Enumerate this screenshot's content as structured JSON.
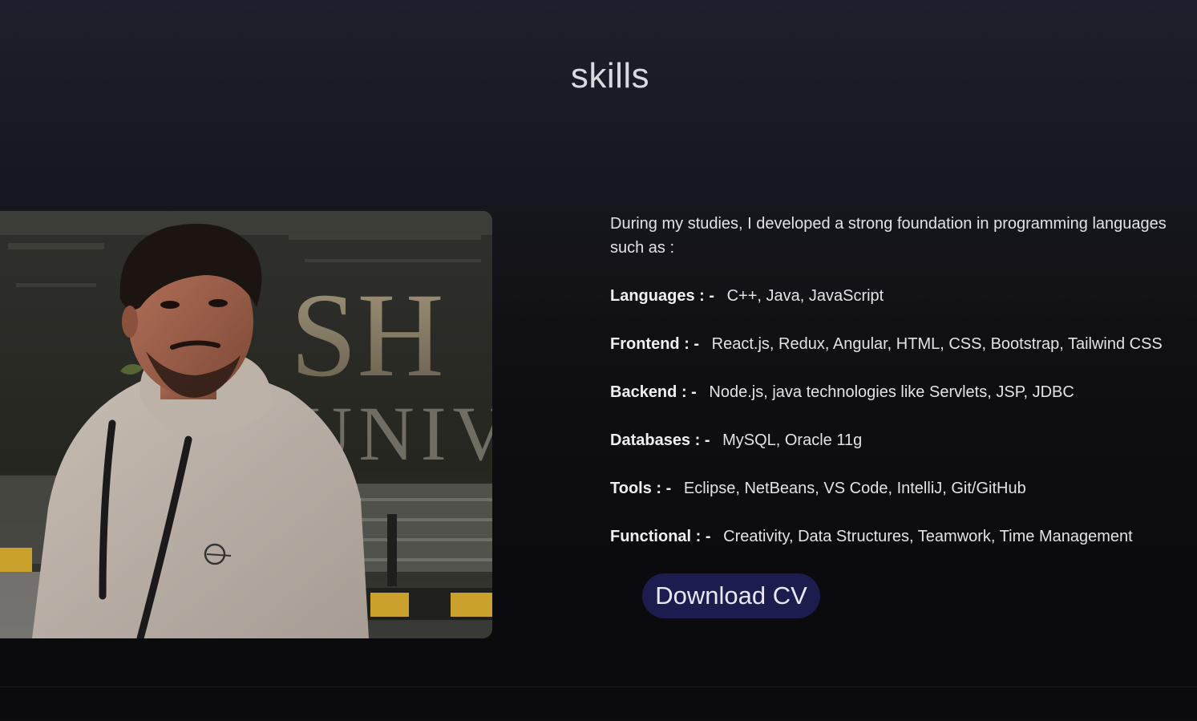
{
  "section": {
    "title": "skills"
  },
  "photo": {
    "alt": "portrait",
    "sign_letters": "SH",
    "sign_letters_2": "UNIV"
  },
  "skills": {
    "intro": "During my studies, I developed a strong foundation in programming languages such as :",
    "separator": ": -",
    "rows": [
      {
        "label": "Languages",
        "value": "C++, Java, JavaScript"
      },
      {
        "label": "Frontend",
        "value": "React.js, Redux, Angular, HTML, CSS, Bootstrap, Tailwind CSS"
      },
      {
        "label": "Backend",
        "value": "Node.js, java technologies like Servlets, JSP, JDBC"
      },
      {
        "label": "Databases",
        "value": "MySQL, Oracle 11g"
      },
      {
        "label": "Tools",
        "value": "Eclipse, NetBeans, VS Code, IntelliJ, Git/GitHub"
      },
      {
        "label": "Functional",
        "value": "Creativity, Data Structures, Teamwork, Time Management"
      }
    ]
  },
  "cv_button": {
    "label": "Download CV"
  },
  "colors": {
    "button_bg": "#1d1c4f",
    "text": "#e2e2e8"
  }
}
